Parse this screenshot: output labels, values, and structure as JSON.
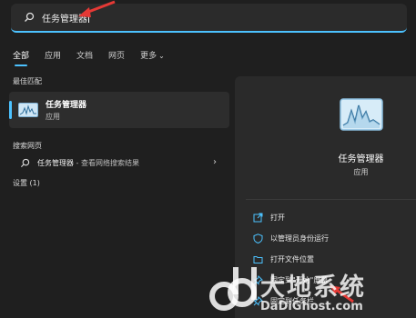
{
  "search": {
    "query": "任务管理器"
  },
  "tabs": [
    {
      "label": "全部"
    },
    {
      "label": "应用"
    },
    {
      "label": "文档"
    },
    {
      "label": "网页"
    },
    {
      "label": "更多"
    }
  ],
  "best_match": {
    "section_title": "最佳匹配",
    "name": "任务管理器",
    "type": "应用"
  },
  "web_search": {
    "section_title": "搜索网页",
    "item_main": "任务管理器",
    "item_sub": " - 查看网络搜索结果"
  },
  "settings": {
    "section_title": "设置 (1)"
  },
  "detail": {
    "title": "任务管理器",
    "subtitle": "应用",
    "actions": [
      {
        "label": "打开",
        "icon": "open-icon"
      },
      {
        "label": "以管理员身份运行",
        "icon": "shield-icon"
      },
      {
        "label": "打开文件位置",
        "icon": "folder-icon"
      },
      {
        "label": "固定到\"开始\"屏幕",
        "icon": "pin-icon"
      },
      {
        "label": "固定到任务栏",
        "icon": "pin-icon"
      }
    ]
  },
  "watermark": {
    "brand": "大地系统",
    "url": "DaDiGhost.com"
  },
  "colors": {
    "accent": "#4cc2ff",
    "annotation": "#e53935"
  }
}
